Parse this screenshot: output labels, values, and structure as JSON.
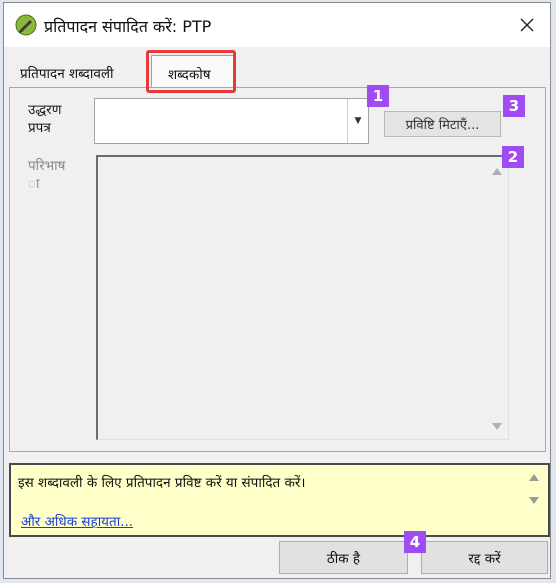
{
  "window": {
    "title": "प्रतिपादन संपादित करें: PTP",
    "close_label": "Close"
  },
  "tabs": [
    {
      "label": "प्रतिपादन शब्दावली",
      "active": false
    },
    {
      "label": "शब्दकोष",
      "active": true
    }
  ],
  "form": {
    "source_label": "उद्धरण\nप्रपत्र",
    "source_value": "",
    "delete_button": "प्रविष्टि मिटाएँ...",
    "definition_label": "परिभाष\nा"
  },
  "help": {
    "text": "इस शब्दावली के लिए प्रतिपादन प्रविष्ट करें या संपादित करें।",
    "link": "और अधिक सहायता..."
  },
  "buttons": {
    "ok": "ठीक है",
    "cancel": "रद्द करें"
  },
  "badges": {
    "b1": "1",
    "b2": "2",
    "b3": "3",
    "b4": "4"
  },
  "icons": {
    "app": "pencil-leaf-icon",
    "close": "close-icon",
    "dropdown": "chevron-down-icon",
    "scroll_up": "scroll-up-icon",
    "scroll_down": "scroll-down-icon"
  },
  "colors": {
    "badge": "#9f4cf2",
    "highlight": "#e53a3a",
    "help_background": "#ffffc8",
    "link": "#1a3fe0"
  }
}
